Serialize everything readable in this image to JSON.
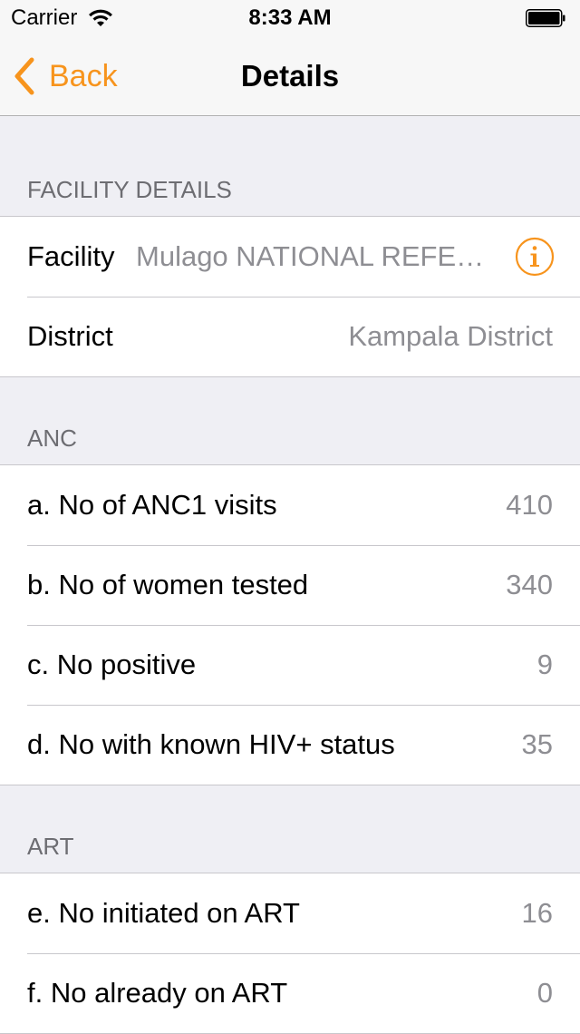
{
  "status_bar": {
    "carrier": "Carrier",
    "time": "8:33 AM"
  },
  "nav": {
    "back_label": "Back",
    "title": "Details"
  },
  "colors": {
    "accent": "#f7941d",
    "secondary_text": "#8e8e93",
    "section_header_text": "#6d6d72",
    "grouped_background": "#efeff4"
  },
  "facility_section": {
    "header": "FACILITY DETAILS",
    "facility_label": "Facility",
    "facility_value": "Mulago NATIONAL REFERRAL HOSPITAL",
    "info_icon": "info-circle-icon",
    "district_label": "District",
    "district_value": "Kampala District"
  },
  "anc_section": {
    "header": "ANC",
    "rows": [
      {
        "label": "a. No of ANC1 visits",
        "value": "410"
      },
      {
        "label": "b. No of women tested",
        "value": "340"
      },
      {
        "label": "c. No positive",
        "value": "9"
      },
      {
        "label": "d. No with known HIV+ status",
        "value": "35"
      }
    ]
  },
  "art_section": {
    "header": "ART",
    "rows": [
      {
        "label": "e. No initiated on ART",
        "value": "16"
      },
      {
        "label": "f. No already on ART",
        "value": "0"
      }
    ]
  }
}
